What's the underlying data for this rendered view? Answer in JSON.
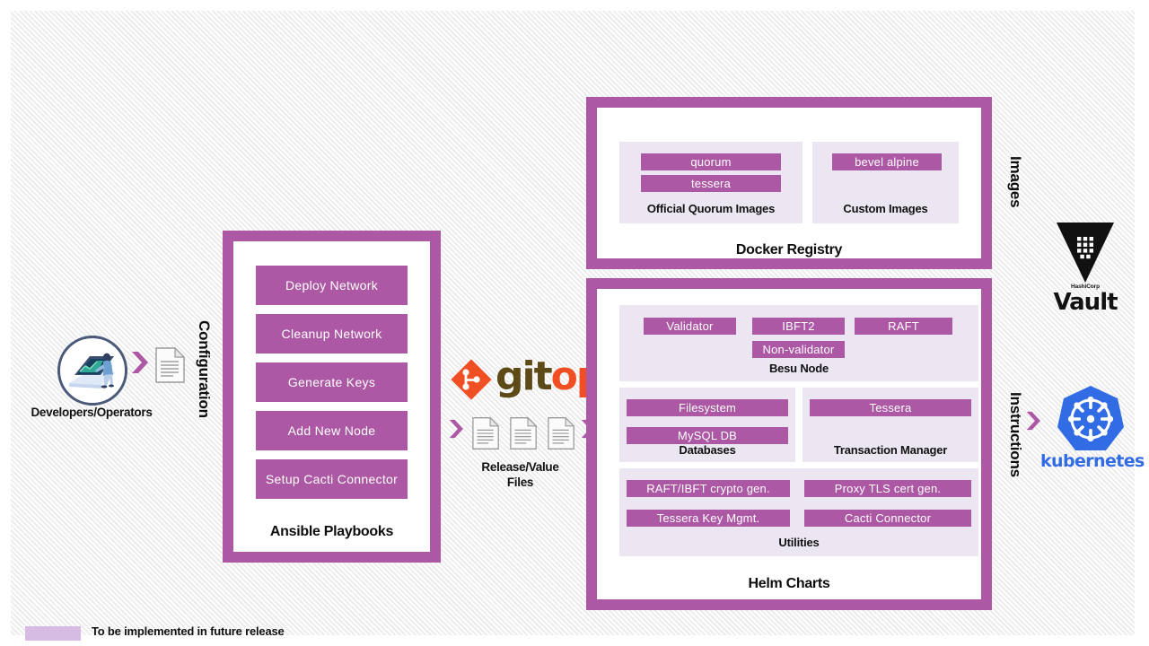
{
  "legend": {
    "swatch_color": "#D6BBE2",
    "text": "To be implemented in future release"
  },
  "colors": {
    "accent_purple": "#AC58A5",
    "group_bg": "#ece6f2",
    "gitops_git": "#5e4a16",
    "gitops_ops": "#f04e23",
    "k8s_blue": "#326ce5"
  },
  "actors": {
    "developers": {
      "label": "Developers/Operators",
      "icon": "developer-at-laptop-illustration"
    }
  },
  "flow_labels": {
    "configuration": "Configuration",
    "images": "Images",
    "instructions": "Instructions"
  },
  "ansible": {
    "card_label": "Ansible Playbooks",
    "playbooks": [
      "Deploy  Network",
      "Cleanup Network",
      "Generate Keys",
      "Add  New Node",
      "Setup Cacti Connector"
    ]
  },
  "gitops": {
    "word_git": "git",
    "word_ops": "ops",
    "files_label_line1": "Release/Value",
    "files_label_line2": "Files",
    "file_count": 3
  },
  "docker_registry": {
    "card_label": "Docker Registry",
    "groups": [
      {
        "label": "Official Quorum Images",
        "chips": [
          "quorum",
          "tessera"
        ]
      },
      {
        "label": "Custom Images",
        "chips": [
          "bevel alpine"
        ]
      }
    ]
  },
  "helm_charts": {
    "card_label": "Helm Charts",
    "besu": {
      "label": "Besu Node",
      "chips_row1": [
        "Validator",
        "IBFT2",
        "RAFT"
      ],
      "chips_row2": [
        "Non-validator"
      ]
    },
    "databases": {
      "label": "Databases",
      "chips": [
        "Filesystem",
        "MySQL DB"
      ]
    },
    "transaction_manager": {
      "label": "Transaction Manager",
      "chips": [
        "Tessera"
      ]
    },
    "utilities": {
      "label": "Utilities",
      "chips_left": [
        "RAFT/IBFT crypto gen.",
        "Tessera Key Mgmt."
      ],
      "chips_right": [
        "Proxy TLS cert gen.",
        "Cacti Connector"
      ]
    }
  },
  "vault": {
    "vendor": "HashiCorp",
    "name": "Vault",
    "icon": "vault-logo-icon"
  },
  "kubernetes": {
    "name": "kubernetes",
    "icon": "kubernetes-helm-wheel-icon"
  }
}
